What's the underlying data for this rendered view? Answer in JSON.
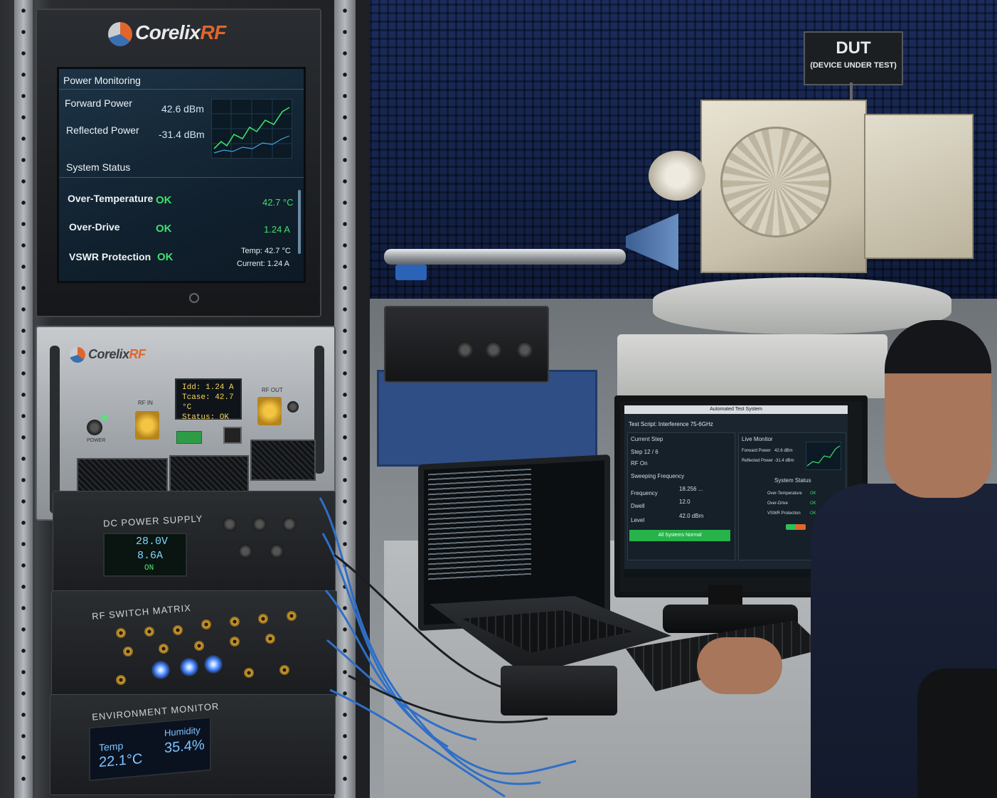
{
  "rack_monitor": {
    "brand": "Corelix",
    "brand_accent": "RF",
    "section_power": "Power Monitoring",
    "forward_label": "Forward Power",
    "forward_value": "42.6 dBm",
    "reflected_label": "Reflected Power",
    "reflected_value": "-31.4 dBm",
    "section_status": "System Status",
    "rows": [
      {
        "label": "Over-Temperature",
        "status": "OK",
        "value": "42.7 °C"
      },
      {
        "label": "Over-Drive",
        "status": "OK",
        "value": "1.24 A"
      },
      {
        "label": "VSWR Protection",
        "status": "OK",
        "value": ""
      }
    ],
    "temp_readout": "Temp: 42.7 °C",
    "current_readout": "Current: 1.24 A"
  },
  "amplifier": {
    "brand": "Corelix",
    "brand_accent": "RF",
    "lcd_lines": [
      "Idd:  1.24 A",
      "Tcase: 42.7 °C",
      "Status:  OK"
    ],
    "rf_in": "RF IN",
    "rf_out": "RF OUT",
    "power_label": "POWER"
  },
  "dc_supply": {
    "title": "DC POWER SUPPLY",
    "voltage": "28.0V",
    "current": "8.6A",
    "state": "ON"
  },
  "rf_switch": {
    "title": "RF SWITCH MATRIX"
  },
  "env_monitor": {
    "title": "ENVIRONMENT MONITOR",
    "temp_label": "Temp",
    "temp_value": "22.1°C",
    "humidity_label": "Humidity",
    "humidity_value": "35.4%"
  },
  "dut_sign": {
    "line1": "DUT",
    "line2": "(DEVICE UNDER TEST)"
  },
  "desktop": {
    "window_title": "Automated Test System",
    "script_label": "Test Script: Interference 75-6GHz",
    "current_step_label": "Current Step",
    "step_text": "Step 12 / 6",
    "rf_on": "RF On",
    "sweeping": "Sweeping Frequency",
    "frequency_label": "Frequency",
    "frequency_value": "18.256 ...",
    "dwell_label": "Dwell",
    "dwell_value": "12.0",
    "level_label": "Level",
    "level_value": "42.0 dBm",
    "all_normal": "All Systems Normal",
    "live_monitor": "Live Monitor",
    "forward_label": "Forward Power",
    "forward_value": "42.6 dBm",
    "reflected_label": "Reflected Power",
    "reflected_value": "-31.4 dBm",
    "system_status": "System Status",
    "status_rows": [
      {
        "label": "Over-Temperature",
        "status": "OK"
      },
      {
        "label": "Over-Drive",
        "status": "OK"
      },
      {
        "label": "VSWR Protection",
        "status": "OK"
      }
    ]
  },
  "colors": {
    "ok_green": "#40e06a",
    "brand_orange": "#e0662d",
    "chamber_blue": "#1b2c5c"
  }
}
